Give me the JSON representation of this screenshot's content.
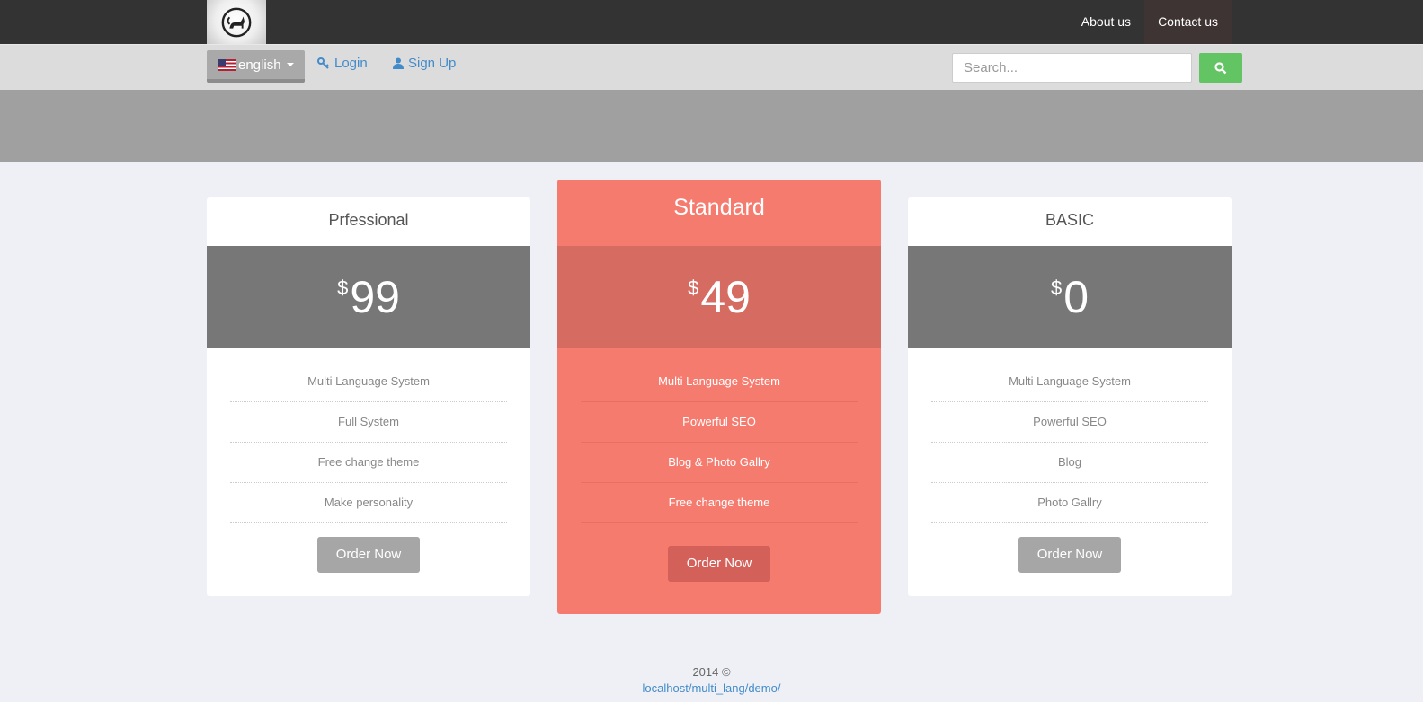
{
  "topnav": {
    "about_label": "About us",
    "contact_label": "Contact us"
  },
  "subbar": {
    "language": "english",
    "login_label": "Login",
    "signup_label": "Sign Up",
    "search_placeholder": "Search..."
  },
  "plans": [
    {
      "name": "Prfessional",
      "currency": "$",
      "price": "99",
      "features": [
        "Multi Language System",
        "Full System",
        "Free change theme",
        "Make personality"
      ],
      "button": "Order Now"
    },
    {
      "name": "Standard",
      "currency": "$",
      "price": "49",
      "features": [
        "Multi Language System",
        "Powerful SEO",
        "Blog & Photo Gallry",
        "Free change theme"
      ],
      "button": "Order Now"
    },
    {
      "name": "BASIC",
      "currency": "$",
      "price": "0",
      "features": [
        "Multi Language System",
        "Powerful SEO",
        "Blog",
        "Photo Gallry"
      ],
      "button": "Order Now"
    }
  ],
  "footer": {
    "copyright": "2014 ©",
    "url": "localhost/multi_lang/demo/"
  },
  "colors": {
    "topbar": "#333333",
    "featured": "#f67b6f",
    "search_button": "#62c462",
    "link": "#428bca"
  }
}
